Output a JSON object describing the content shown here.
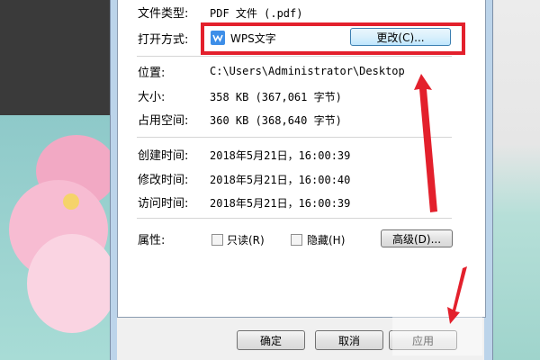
{
  "rows": {
    "file_type": {
      "label": "文件类型:",
      "value": "PDF 文件 (.pdf)"
    },
    "opens_with": {
      "label": "打开方式:",
      "app": "WPS文字",
      "change_button": "更改(C)..."
    },
    "location": {
      "label": "位置:",
      "value": "C:\\Users\\Administrator\\Desktop"
    },
    "size": {
      "label": "大小:",
      "value": "358 KB (367,061 字节)"
    },
    "size_on_disk": {
      "label": "占用空间:",
      "value": "360 KB (368,640 字节)"
    },
    "created": {
      "label": "创建时间:",
      "value": "2018年5月21日，16:00:39"
    },
    "modified": {
      "label": "修改时间:",
      "value": "2018年5月21日，16:00:40"
    },
    "accessed": {
      "label": "访问时间:",
      "value": "2018年5月21日，16:00:39"
    }
  },
  "attributes": {
    "label": "属性:",
    "readonly": "只读(R)",
    "hidden": "隐藏(H)",
    "advanced_button": "高级(D)..."
  },
  "buttons": {
    "ok": "确定",
    "cancel": "取消",
    "apply": "应用"
  },
  "colors": {
    "annotation_red": "#e3202c",
    "wps_blue": "#3d8ee8"
  }
}
